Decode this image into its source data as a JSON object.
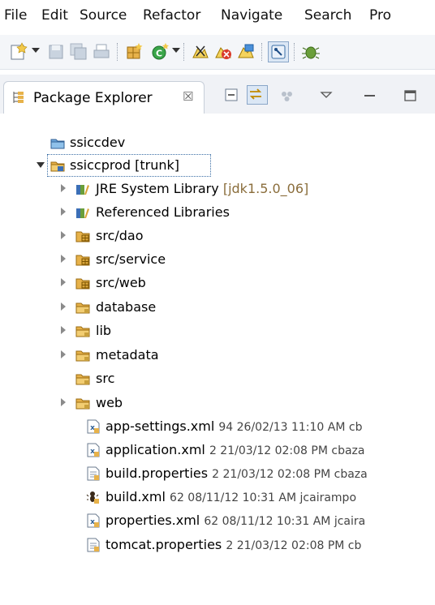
{
  "menubar": {
    "items": [
      "File",
      "Edit",
      "Source",
      "Refactor",
      "Navigate",
      "Search",
      "Pro"
    ]
  },
  "toolbar": {
    "buttons": [
      {
        "icon": "new-wizard-icon",
        "dropdown": true
      },
      {
        "icon": "save-icon"
      },
      {
        "icon": "save-all-icon"
      },
      {
        "icon": "print-icon"
      },
      {
        "icon": "new-package-icon"
      },
      {
        "icon": "new-class-icon",
        "dropdown": true
      },
      {
        "icon": "svn-commit-icon"
      },
      {
        "icon": "svn-revert-icon"
      },
      {
        "icon": "svn-update-icon"
      },
      {
        "icon": "toggle-mark-occurrences-icon",
        "pressed": true
      },
      {
        "icon": "debug-icon"
      }
    ]
  },
  "view": {
    "tab_label": "Package Explorer",
    "tab_close": "☒",
    "buttons": [
      "collapse-all-icon",
      "link-with-editor-icon",
      "focus-task-icon",
      "view-menu-icon",
      "minimize-icon",
      "maximize-icon"
    ]
  },
  "tree": {
    "items": [
      {
        "label": "ssiccdev",
        "icon": "closed-project-icon",
        "twisty": "none",
        "indent": 0
      },
      {
        "label": "ssiccprod",
        "decoration": "[trunk]",
        "icon": "svn-project-icon",
        "twisty": "open",
        "indent": 0,
        "selected": true
      },
      {
        "label": "JRE System Library",
        "decoration": "[jdk1.5.0_06]",
        "icon": "library-icon",
        "twisty": "closed",
        "indent": 1
      },
      {
        "label": "Referenced Libraries",
        "icon": "library-icon",
        "twisty": "closed",
        "indent": 1
      },
      {
        "label": "src/dao",
        "icon": "source-folder-icon",
        "twisty": "closed",
        "indent": 1
      },
      {
        "label": "src/service",
        "icon": "source-folder-icon",
        "twisty": "closed",
        "indent": 1
      },
      {
        "label": "src/web",
        "icon": "source-folder-icon",
        "twisty": "closed",
        "indent": 1
      },
      {
        "label": "database",
        "icon": "folder-icon",
        "twisty": "closed",
        "indent": 1
      },
      {
        "label": "lib",
        "icon": "folder-icon",
        "twisty": "closed",
        "indent": 1
      },
      {
        "label": "metadata",
        "icon": "folder-icon",
        "twisty": "closed",
        "indent": 1
      },
      {
        "label": "src",
        "icon": "folder-icon",
        "twisty": "none",
        "indent": 1
      },
      {
        "label": "web",
        "icon": "folder-icon",
        "twisty": "closed",
        "indent": 1
      },
      {
        "label": "app-settings.xml",
        "meta": "94  26/02/13 11:10 AM  cb",
        "icon": "xml-file-icon",
        "twisty": "none",
        "indent": 2
      },
      {
        "label": "application.xml",
        "meta": "2  21/03/12 02:08 PM  cbaza",
        "icon": "xml-file-icon",
        "twisty": "none",
        "indent": 2
      },
      {
        "label": "build.properties",
        "meta": "2  21/03/12 02:08 PM  cbaza",
        "icon": "properties-file-icon",
        "twisty": "none",
        "indent": 2
      },
      {
        "label": "build.xml",
        "meta": "62  08/11/12 10:31 AM  jcairampo",
        "icon": "ant-file-icon",
        "twisty": "none",
        "indent": 2
      },
      {
        "label": "properties.xml",
        "meta": "62  08/11/12 10:31 AM  jcaira",
        "icon": "xml-file-icon",
        "twisty": "none",
        "indent": 2
      },
      {
        "label": "tomcat.properties",
        "meta": "2  21/03/12 02:08 PM  cb",
        "icon": "properties-file-icon",
        "twisty": "none",
        "indent": 2
      }
    ]
  },
  "colors": {
    "selection_outline": "#3a6ea5",
    "decoration": "#8a6d3b",
    "folder": "#e8b64c",
    "library": "#3b6fb6"
  }
}
